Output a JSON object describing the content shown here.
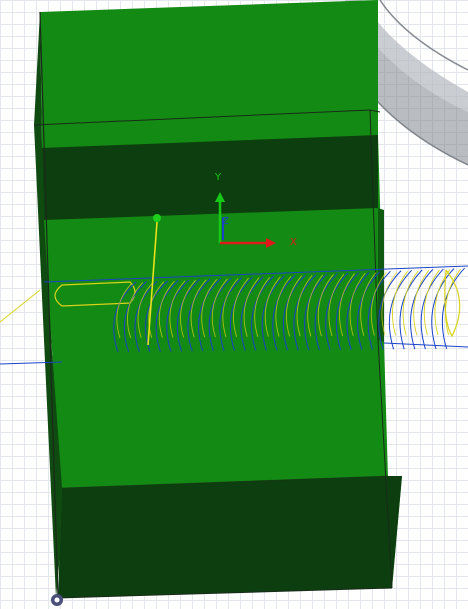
{
  "viewport": {
    "axis_labels": {
      "x": "X",
      "y": "Y",
      "z": "Z"
    },
    "colors": {
      "background": "#ffffff",
      "grid": "#e3e7ec",
      "body_main": "#138a13",
      "body_dark": "#0d3e0f",
      "body_edge": "#1a2a1a",
      "thread_blue": "#1a43c9",
      "thread_yellow": "#d8d21a",
      "axis_x": "#e01a1a",
      "axis_y": "#17c917",
      "axis_z": "#1a43c9",
      "ghost_part": "#9aa0a8"
    },
    "icons": {
      "origin": "origin-icon",
      "triad": "axis-triad-icon",
      "manipulator": "move-manipulator-icon"
    }
  }
}
